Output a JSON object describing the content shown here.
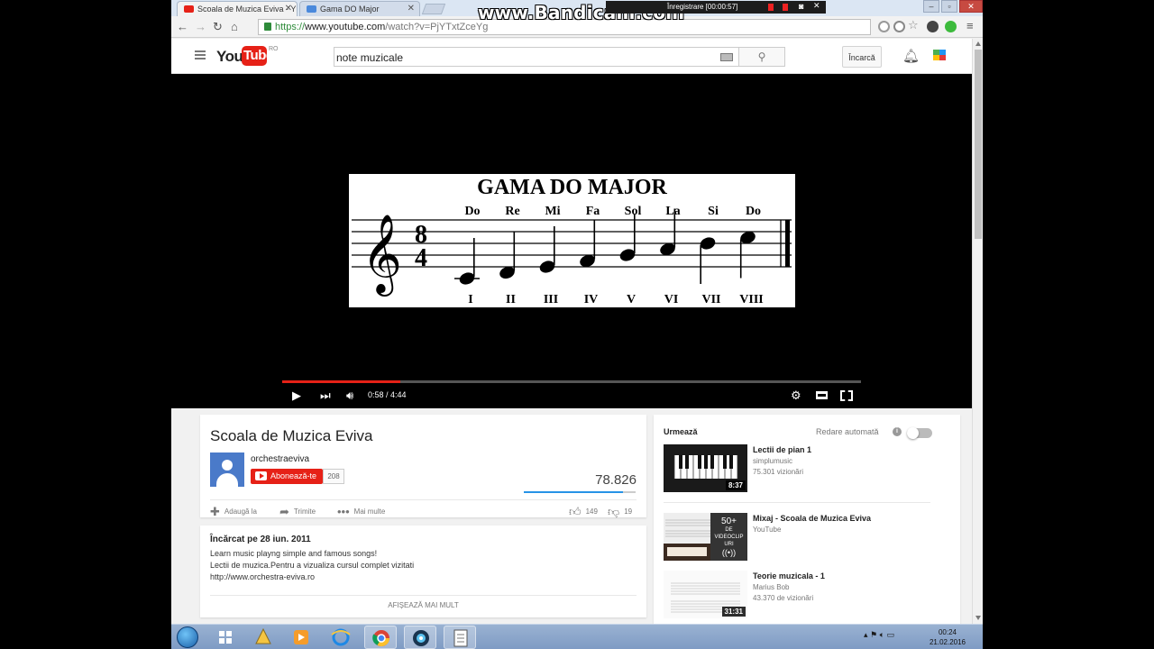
{
  "browser": {
    "tabs": [
      {
        "label": "Scoala de Muzica Eviva - Y",
        "active": true
      },
      {
        "label": "Gama DO Major",
        "active": false
      }
    ],
    "url": {
      "scheme": "https://",
      "host": "www.youtube.com",
      "path": "/watch?v=PjYTxtZceYg"
    }
  },
  "overlay": {
    "watermark": "www.Bandicam.com",
    "recording": "Înregistrare [00:00:57]"
  },
  "youtube": {
    "logo_you": "You",
    "logo_tube": "Tube",
    "region": "RO",
    "search_value": "note muzicale",
    "upload_label": "Încarcă"
  },
  "player": {
    "video_title": "GAMA DO MAJOR",
    "notes": [
      "Do",
      "Re",
      "Mi",
      "Fa",
      "Sol",
      "La",
      "Si",
      "Do"
    ],
    "degrees": [
      "I",
      "II",
      "III",
      "IV",
      "V",
      "VI",
      "VII",
      "VIII"
    ],
    "time_signature": {
      "top": "8",
      "bottom": "4"
    },
    "time_current": "0:58",
    "time_total": "4:44",
    "progress_fraction": 0.204
  },
  "video": {
    "title": "Scoala de Muzica Eviva",
    "channel": "orchestraeviva",
    "subscribe_label": "Abonează-te",
    "subscriber_count": "208",
    "view_count": "78.826",
    "like_fraction": 0.89,
    "actions": {
      "add_to": "Adaugă la",
      "share": "Trimite",
      "more": "Mai multe",
      "likes": "149",
      "dislikes": "19"
    }
  },
  "description": {
    "uploaded": "Încărcat pe 28 iun. 2011",
    "lines": [
      "Learn music playng simple and famous songs!",
      "Lectii de muzica.Pentru a vizualiza cursul complet vizitati",
      "http://www.orchestra-eviva.ro"
    ],
    "show_more": "AFIȘEAZĂ MAI MULT"
  },
  "sidebar": {
    "up_next": "Urmează",
    "autoplay": "Redare automată",
    "autoplay_info": "i",
    "items": [
      {
        "title": "Lectii de pian 1",
        "channel": "simplumusic",
        "views": "75.301 vizionări",
        "duration": "8:37"
      },
      {
        "title": "Mixaj - Scoala de Muzica Eviva",
        "channel": "YouTube",
        "views": "",
        "duration": "",
        "badge_count": "50+",
        "badge_text_1": "DE",
        "badge_text_2": "VIDEOCLIP",
        "badge_text_3": "URI"
      },
      {
        "title": "Teorie muzicala - 1",
        "channel": "Marius Bob",
        "views": "43.370 de vizionări",
        "duration": "31:31"
      }
    ]
  },
  "taskbar": {
    "time": "00:24",
    "date": "21.02.2016"
  },
  "colors": {
    "youtube_red": "#e62117",
    "progress_red": "#e52117",
    "like_blue": "#2793e6",
    "https_green": "#2e8b3a"
  },
  "icons": {
    "back": "arrow-left-icon",
    "forward": "arrow-right-icon",
    "reload": "reload-icon",
    "home": "home-icon",
    "search": "search-icon",
    "bell": "bell-icon",
    "play": "play-icon",
    "next": "next-icon",
    "volume": "volume-icon",
    "settings": "gear-icon",
    "theater": "theater-icon",
    "fullscreen": "fullscreen-icon"
  }
}
